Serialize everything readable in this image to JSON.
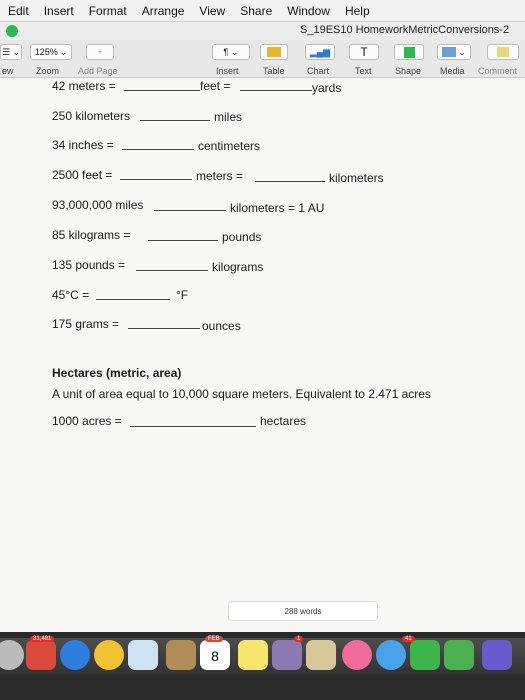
{
  "menubar": {
    "items": [
      "Edit",
      "Insert",
      "Format",
      "Arrange",
      "View",
      "Share",
      "Window",
      "Help"
    ]
  },
  "window": {
    "title": "S_19ES10 HomeworkMetricConversions-2"
  },
  "toolbar": {
    "view_label": "ew",
    "zoom_value": "125%",
    "zoom_label": "Zoom",
    "add_page_label": "Add Page",
    "insert_label": "Insert",
    "table_label": "Table",
    "chart_label": "Chart",
    "text_label": "Text",
    "shape_label": "Shape",
    "media_label": "Media",
    "comment_label": "Comment"
  },
  "document": {
    "rows": [
      {
        "a": "42 meters =",
        "b": "feet =",
        "c": "yards"
      },
      {
        "a": "250 kilometers",
        "b": "miles"
      },
      {
        "a": "34 inches =",
        "b": "centimeters"
      },
      {
        "a": "2500 feet =",
        "b": "meters =",
        "c": "kilometers"
      },
      {
        "a": "93,000,000 miles",
        "b": "kilometers = 1 AU"
      },
      {
        "a": "85 kilograms =",
        "b": "pounds"
      },
      {
        "a": "135 pounds =",
        "b": "kilograms"
      },
      {
        "a": "45°C =",
        "b": "°F"
      },
      {
        "a": "175 grams =",
        "b": "ounces"
      }
    ],
    "hectares_heading": "Hectares (metric, area)",
    "hectares_desc": "A unit of area equal to 10,000 square meters. Equivalent to 2.471 acres",
    "hectares_row": {
      "a": "1000 acres =",
      "b": "hectares"
    },
    "word_count": "288 words"
  },
  "dock": {
    "badge_a": "31,481",
    "badge_b": "1",
    "badge_c": "41",
    "calendar_day": "8",
    "calendar_month": "FEB"
  }
}
